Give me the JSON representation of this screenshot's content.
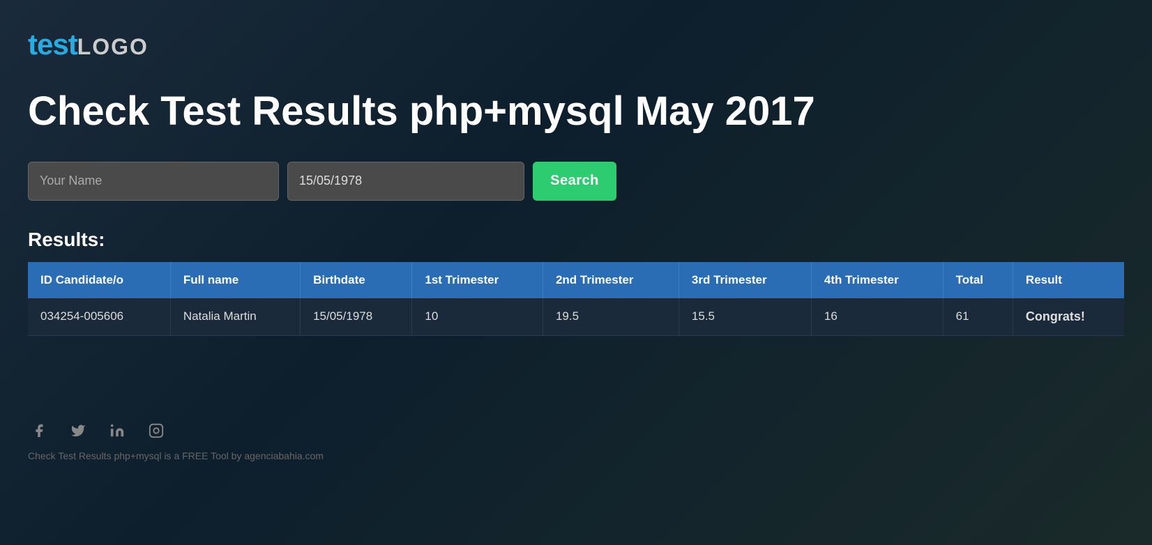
{
  "logo": {
    "test_part": "test",
    "logo_part": "LOGO"
  },
  "page": {
    "title": "Check Test Results php+mysql May 2017"
  },
  "form": {
    "name_placeholder": "Your Name",
    "date_value": "15/05/1978",
    "search_button_label": "Search"
  },
  "results": {
    "label": "Results:",
    "table": {
      "headers": [
        "ID Candidate/o",
        "Full name",
        "Birthdate",
        "1st Trimester",
        "2nd Trimester",
        "3rd Trimester",
        "4th Trimester",
        "Total",
        "Result"
      ],
      "rows": [
        {
          "id": "034254-005606",
          "full_name": "Natalia Martin",
          "birthdate": "15/05/1978",
          "trim1": "10",
          "trim2": "19.5",
          "trim3": "15.5",
          "trim4": "16",
          "total": "61",
          "result": "Congrats!"
        }
      ]
    }
  },
  "footer": {
    "social_icons": [
      "facebook-icon",
      "twitter-icon",
      "linkedin-icon",
      "instagram-icon"
    ],
    "copyright_text": "Check Test Results php+mysql is a FREE Tool by agenciabahia.com"
  },
  "colors": {
    "accent_blue": "#29abe2",
    "accent_green": "#2ecc71",
    "table_header_bg": "#2a6db5",
    "background_dark": "#1a2a3a"
  }
}
